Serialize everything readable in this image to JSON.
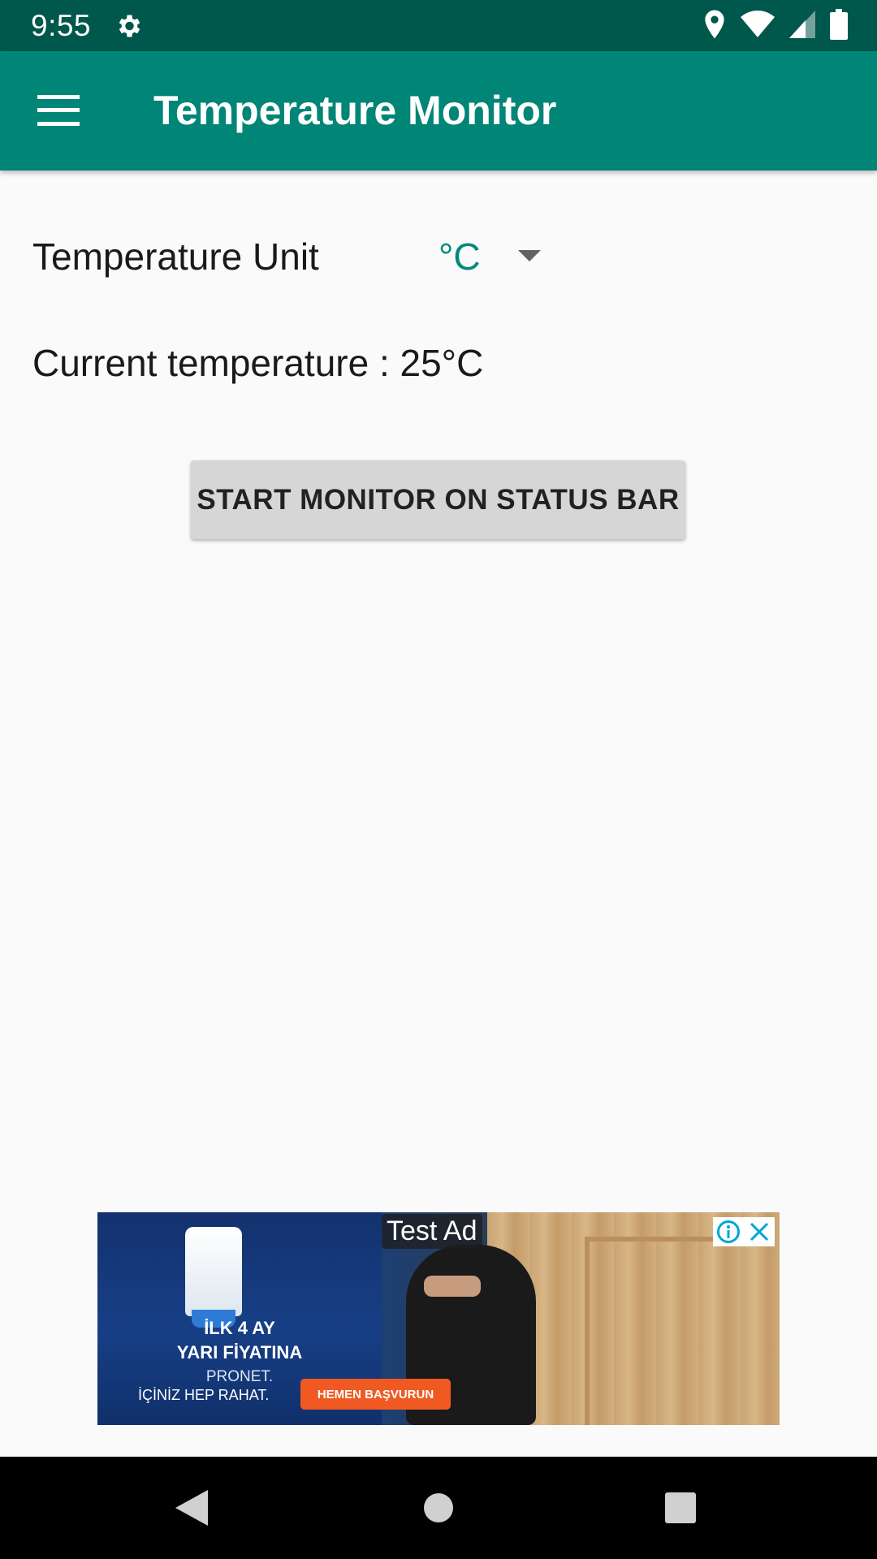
{
  "status_bar": {
    "time": "9:55",
    "icons": [
      "settings-icon",
      "location-icon",
      "wifi-icon",
      "signal-icon",
      "battery-icon"
    ]
  },
  "app_bar": {
    "title": "Temperature Monitor",
    "menu_icon": "menu-icon"
  },
  "settings": {
    "unit_label": "Temperature Unit",
    "unit_value": "°C",
    "current_temperature": "Current temperature : 25°C"
  },
  "actions": {
    "start_button": "START MONITOR ON STATUS BAR"
  },
  "ad": {
    "label": "Test Ad",
    "headline_line1": "İLK 4 AY",
    "headline_line2": "YARI FİYATINA",
    "brand": "PRONET.",
    "slogan": "İÇİNİZ HEP RAHAT.",
    "cta": "HEMEN BAŞVURUN"
  },
  "nav_bar": {
    "icons": [
      "back-icon",
      "home-icon",
      "recents-icon"
    ]
  },
  "colors": {
    "status_bar": "#00574b",
    "app_bar": "#008577",
    "accent": "#00897b",
    "background": "#fafafa",
    "button": "#d6d6d6"
  }
}
